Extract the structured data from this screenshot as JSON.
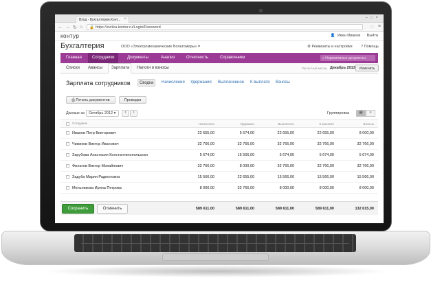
{
  "browser": {
    "tab_title": "Вход - Бухгалтерия.Конт...",
    "url": "https://evrika.kontur.ru/Login/Password"
  },
  "kontur": {
    "logo": "кoнтур",
    "user": "Иван Иванов",
    "logout": "Выйти"
  },
  "app": {
    "title": "Бухгалтерия",
    "org": "ООО «Электромеханические Вольтомеры»",
    "settings": "Реквизиты и настройки",
    "help": "Помощь"
  },
  "main_nav": {
    "items": [
      "Главная",
      "Сотрудники",
      "Документы",
      "Анализ",
      "Отчетность",
      "Справочники"
    ],
    "active": "Сотрудники",
    "search_placeholder": "Нормативные документы"
  },
  "sub_nav": {
    "items": [
      "Списки",
      "Авансы",
      "Зарплата",
      "Налоги и взносы"
    ],
    "active": "Зарплата",
    "period_label": "Расчетный месяц",
    "period_value": "Декабрь 2013",
    "change_button": "Изменить"
  },
  "page": {
    "title": "Зарплата сотрудников",
    "tabs": [
      "Сводка",
      "Начисления",
      "Удержания",
      "Выплаченное",
      "К выплате",
      "Взносы"
    ],
    "active_tab": "Сводка",
    "print_button": "Печать документов",
    "posting_button": "Проводки",
    "data_for_label": "Данные за",
    "month": "Октябрь 2012",
    "grouping_label": "Группировка"
  },
  "table": {
    "columns": [
      "Сотрудник",
      "Начислено",
      "Удержано",
      "Выплачено",
      "К выплате",
      "Взносы"
    ],
    "rows": [
      [
        "Иванов Петр Викторович",
        "22 655,00",
        "5 674,00",
        "22 655,00",
        "22 655,00",
        "8 000,00"
      ],
      [
        "Чижиков Виктор Иванович",
        "32 766,00",
        "32 766,00",
        "32 766,00",
        "32 766,00",
        "32 766,00"
      ],
      [
        "Зарубова Анастасия Константинопольская",
        "5 674,00",
        "15 566,00",
        "5 674,00",
        "5 674,00",
        "5 674,00"
      ],
      [
        "Филатов Виктор Михайлович",
        "32 766,00",
        "8 000,00",
        "32 766,00",
        "32 766,00",
        "32 766,00"
      ],
      [
        "Задуба Мария Радионовна",
        "15 566,00",
        "22 655,00",
        "15 566,00",
        "15 566,00",
        "15 566,00"
      ],
      [
        "Мельникова Ирина Петрова",
        "8 000,00",
        "32 766,00",
        "8 000,00",
        "8 000,00",
        "8 000,00"
      ]
    ],
    "totals": [
      "589 611,00",
      "589 611,00",
      "589 611,00",
      "589 611,00",
      "132 615,00"
    ]
  },
  "footer": {
    "save_button": "Сохранить",
    "cancel_button": "Отменить"
  },
  "colors": {
    "nav_purple": "#9b3b96",
    "nav_active": "#7a2777",
    "save_green": "#3f9c3a",
    "link_blue": "#2b6cb0"
  }
}
